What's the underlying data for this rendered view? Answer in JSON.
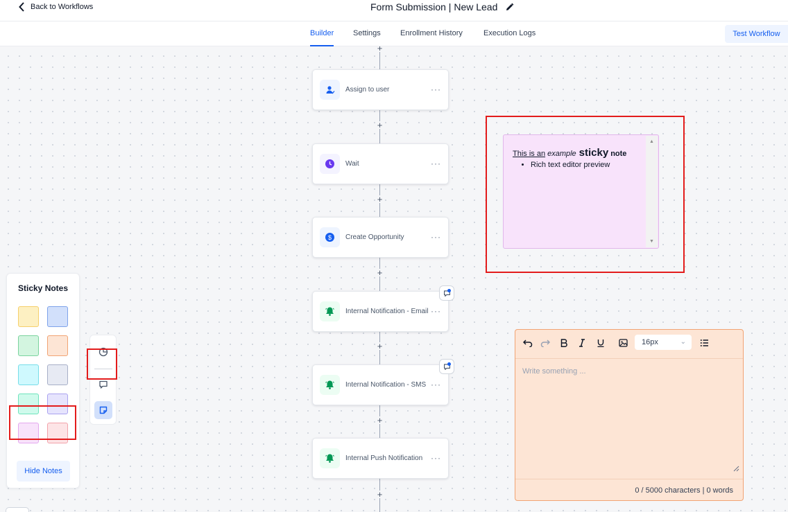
{
  "header": {
    "back_label": "Back to Workflows",
    "title": "Form Submission | New Lead"
  },
  "tabs": [
    {
      "label": "Builder",
      "active": true
    },
    {
      "label": "Settings",
      "active": false
    },
    {
      "label": "Enrollment History",
      "active": false
    },
    {
      "label": "Execution Logs",
      "active": false
    }
  ],
  "test_workflow_label": "Test Workflow",
  "workflow": {
    "nodes": [
      {
        "label": "Assign to user",
        "icon": "assign-user-icon",
        "color": "#155eef",
        "has_comment": false
      },
      {
        "label": "Wait",
        "icon": "clock-icon",
        "color": "#6938ef",
        "has_comment": false
      },
      {
        "label": "Create Opportunity",
        "icon": "dollar-icon",
        "color": "#155eef",
        "has_comment": false
      },
      {
        "label": "Internal Notification - Email",
        "icon": "bell-icon",
        "color": "#039855",
        "has_comment": true
      },
      {
        "label": "Internal Notification - SMS",
        "icon": "bell-icon",
        "color": "#039855",
        "has_comment": true
      },
      {
        "label": "Internal Push Notification",
        "icon": "bell-icon",
        "color": "#039855",
        "has_comment": false
      }
    ],
    "plus_symbol": "+",
    "menu_symbol": "···"
  },
  "sticky_notes_panel": {
    "title": "Sticky Notes",
    "colors": [
      {
        "fill": "#fdf0c2",
        "border": "#f5cf6b"
      },
      {
        "fill": "#d2e0fb",
        "border": "#7ea2ea"
      },
      {
        "fill": "#d3f5e0",
        "border": "#7bd39e"
      },
      {
        "fill": "#fde5d5",
        "border": "#f1a373"
      },
      {
        "fill": "#cff9fe",
        "border": "#77dde8"
      },
      {
        "fill": "#e7eaf3",
        "border": "#a7afc7"
      },
      {
        "fill": "#cffaec",
        "border": "#6ee3bc"
      },
      {
        "fill": "#e6e4fd",
        "border": "#aaa2f0"
      },
      {
        "fill": "#f8e3fb",
        "border": "#e4a8ee"
      },
      {
        "fill": "#fde4e6",
        "border": "#f2a2aa"
      }
    ],
    "hide_label": "Hide Notes"
  },
  "sticky_preview": {
    "part1": "This is an",
    "part2": "example",
    "part3": "sticky",
    "part4": "note",
    "bullet": "Rich text editor preview",
    "fill": "#f8e3fb"
  },
  "editor": {
    "font_size": "16px",
    "placeholder": "Write something ...",
    "count": "0 / 5000 characters | 0 words",
    "fill": "#fde5d5"
  },
  "accent_color": "#155eef",
  "highlight_color": "#e31b1b"
}
